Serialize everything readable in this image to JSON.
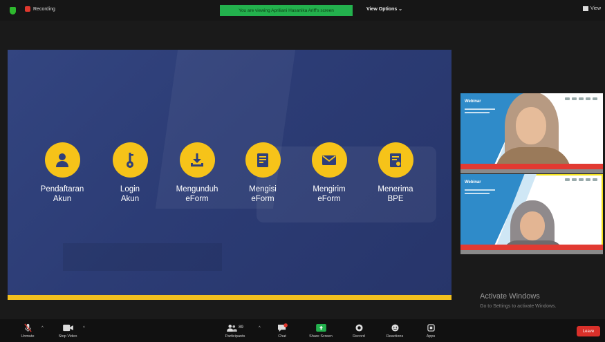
{
  "topbar": {
    "recording_label": "Recording",
    "banner_text": "You are viewing Apriliani Hasanika Ariff's screen",
    "view_options": "View Options ⌄",
    "view_button": "View"
  },
  "presentation": {
    "steps": [
      {
        "label": "Pendaftaran\nAkun",
        "icon": "user-icon"
      },
      {
        "label": "Login\nAkun",
        "icon": "key-icon"
      },
      {
        "label": "Mengunduh\neForm",
        "icon": "download-icon"
      },
      {
        "label": "Mengisi\neForm",
        "icon": "form-icon"
      },
      {
        "label": "Mengirim\neForm",
        "icon": "mail-icon"
      },
      {
        "label": "Menerima\nBPE",
        "icon": "certificate-icon"
      }
    ],
    "accent_color": "#f6c319",
    "bg_color": "#2f3f7a"
  },
  "video_tiles": [
    {
      "title": "Webinar"
    },
    {
      "title": "Webinar"
    }
  ],
  "watermark": {
    "title": "Activate Windows",
    "subtitle": "Go to Settings to activate Windows."
  },
  "toolbar": {
    "unmute": "Unmute",
    "stop_video": "Stop Video",
    "participants": "Participants",
    "participants_count": "89",
    "chat": "Chat",
    "share_screen": "Share Screen",
    "record": "Record",
    "reactions": "Reactions",
    "apps": "Apps",
    "leave": "Leave"
  }
}
